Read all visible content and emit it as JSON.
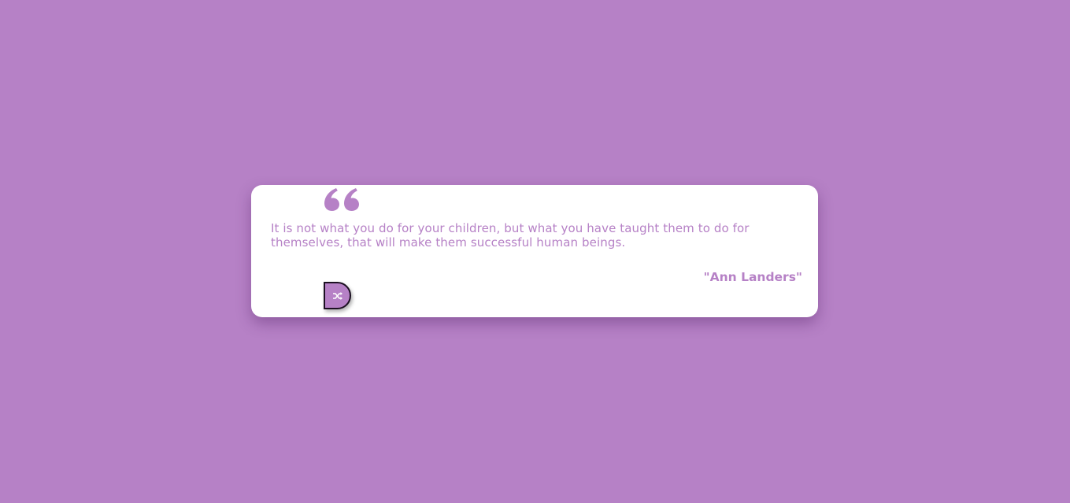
{
  "theme": {
    "background": "#b681c6",
    "card": "#ffffff",
    "accent": "#b681c6"
  },
  "quote": {
    "icon": "quote-left-icon",
    "text": "It is not what you do for your children, but what you have taught them to do for themselves, that will make them successful human beings.",
    "author": "\"Ann Landers\""
  },
  "controls": {
    "new_quote_icon": "shuffle-icon"
  }
}
